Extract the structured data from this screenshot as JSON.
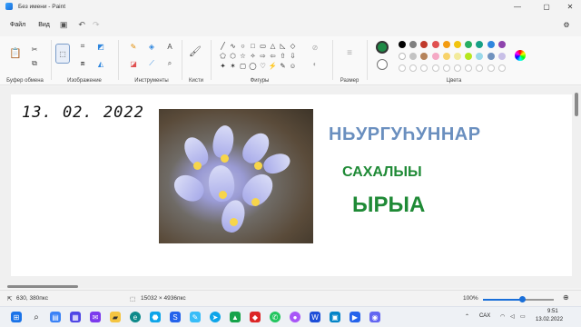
{
  "window": {
    "title": "Без имени - Paint",
    "minimize": "—",
    "maximize": "▢",
    "close": "✕"
  },
  "menu": {
    "file": "Файл",
    "view": "Вид",
    "save_icon": "save-icon",
    "undo_icon": "undo-icon",
    "redo_icon": "redo-icon",
    "settings_icon": "gear-icon"
  },
  "ribbon": {
    "groups": {
      "clipboard": "Буфер обмена",
      "image": "Изображение",
      "tools": "Инструменты",
      "brushes": "Кисти",
      "shapes": "Фигуры",
      "size": "Размер",
      "colors": "Цвета"
    },
    "shapes": [
      "╱",
      "∿",
      "○",
      "□",
      "▭",
      "△",
      "◺",
      "◇",
      "⬠",
      "⬡",
      "☆",
      "✧",
      "⇨",
      "⇦",
      "⇧",
      "⇩",
      "✦",
      "✶",
      "▢",
      "◯",
      "♡",
      "⚡",
      "✎",
      "☺"
    ],
    "primary_color": "#1e8a46",
    "secondary_color": "#ffffff",
    "palette": [
      "#000000",
      "#7f7f7f",
      "#c0392b",
      "#e05050",
      "#f39c12",
      "#f1c40f",
      "#27ae60",
      "#16a085",
      "#2e86de",
      "#8e44ad",
      "#ffffff",
      "#c3c3c3",
      "#b5835a",
      "#f5a9c5",
      "#f7d26a",
      "#f2ea9b",
      "#b5e61d",
      "#99d9ea",
      "#7092be",
      "#c8bfe7"
    ]
  },
  "canvas": {
    "date_text": "13. 02. 2022",
    "line1": "НЬУРГУҺУННАР",
    "line2": "САХАЛЫЫ",
    "line3": "ЫРЫА"
  },
  "status": {
    "cursor": "630, 380пкс",
    "size": "15032 × 4936пкс",
    "zoom": "100%",
    "zoom_level": 0.55
  },
  "taskbar": {
    "lang": "САХ",
    "time": "9:51",
    "date": "13.02.2022"
  }
}
